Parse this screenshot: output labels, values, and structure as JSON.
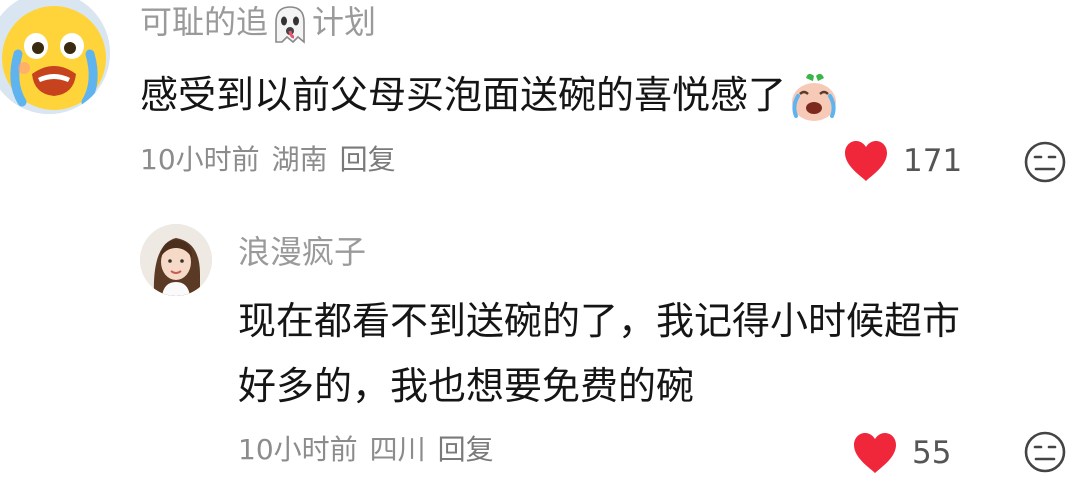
{
  "comments": [
    {
      "username": "可耻的追",
      "username_suffix": "计划",
      "username_emoji": "ghost-emoji",
      "text": "感受到以前父母买泡面送碗的喜悦感了",
      "text_emoji": "crying-face-emoji",
      "time": "10小时前",
      "location": "湖南",
      "reply_label": "回复",
      "likes": "171",
      "avatar_icon": "crying-cartoon-face-avatar"
    },
    {
      "username": "浪漫疯子",
      "text_line1": "现在都看不到送碗的了，我记得小时候超市",
      "text_line2": "好多的，我也想要免费的碗",
      "time": "10小时前",
      "location": "四川",
      "reply_label": "回复",
      "likes": "55",
      "avatar_icon": "woman-portrait-avatar"
    }
  ],
  "icons": {
    "like": "heart-icon",
    "dislike": "sad-face-icon"
  },
  "colors": {
    "like_heart": "#f0263b",
    "meta_text": "#8c8c8c",
    "username": "#9a9a9a",
    "body_text": "#151515"
  }
}
